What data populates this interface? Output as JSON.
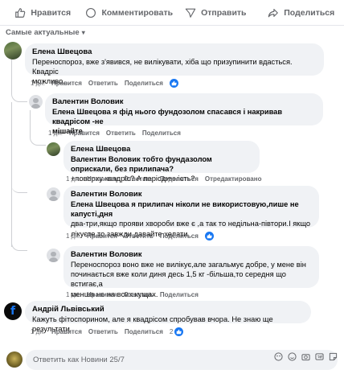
{
  "actions": {
    "like": "Нравится",
    "comment": "Комментировать",
    "send": "Отправить",
    "share": "Поделиться"
  },
  "sort": {
    "label": "Самые актуальные"
  },
  "comments": [
    {
      "name": "Елена Швецова",
      "lines": [
        "Переноспороз, вже з'явився, не вилікувати, хіба що призупинити вдасться. Квадріс",
        "можливо..."
      ],
      "time": "1 дн.",
      "like": "Нравится",
      "reply": "Ответить",
      "share": "Поделиться"
    },
    {
      "name": "Валентин Воловик",
      "lines": [
        "Елена Швецова я фід нього фундозолом спасався і накривав квадрісом -не",
        "мішайте"
      ],
      "time": "1 дн.",
      "like": "Нравится",
      "reply": "Ответить",
      "share": "Поделиться"
    },
    {
      "name": "Елена Швецова",
      "lines": [
        "Валентин Воловик тобто фундазолом оприскали, без прилипача?",
        "+поверху квадріс? А періодичність?"
      ],
      "time": "1 дн.",
      "like": "Нравится",
      "reply": "Ответить",
      "share": "Поделиться",
      "edited": "Отредактировано"
    },
    {
      "name": "Валентин Воловик",
      "lines": [
        "Елена Швецова я прилипач ніколи не використовую,лише не капусті,дня",
        "два-три,якщо прояви хвороби вже є ,а так то недільна-півтори.І якщо",
        "лікуєте,то завжди давайте хелати."
      ],
      "time": "1 дн.",
      "like": "Нравится",
      "reply": "Ответить",
      "share": "Поделиться"
    },
    {
      "name": "Валентин Воловик",
      "lines": [
        "Переноспороз вонo вже не вилікує,але загальмує добре, у мене він",
        "починається вже коли диня десь 1,5 кг -більша,то середня що встигає,а",
        "менша не на всих кущах."
      ],
      "time": "1 дн.",
      "like": "Нравится",
      "reply": "Ответить",
      "share": "Поделиться"
    },
    {
      "name": "Андрій Львівський",
      "lines": [
        "Кажуть фітоспорином, але я квадрісом спробував вчора. Не знаю ще результати"
      ],
      "time": "1 дн.",
      "like": "Нравится",
      "reply": "Ответить",
      "share": "Поделиться",
      "reactions": "2"
    }
  ],
  "composer": {
    "placeholder": "Ответить как Новини 25/7"
  },
  "colors": {
    "accent": "#1877f2",
    "muted": "#65676b",
    "bubble": "#f0f2f5"
  }
}
